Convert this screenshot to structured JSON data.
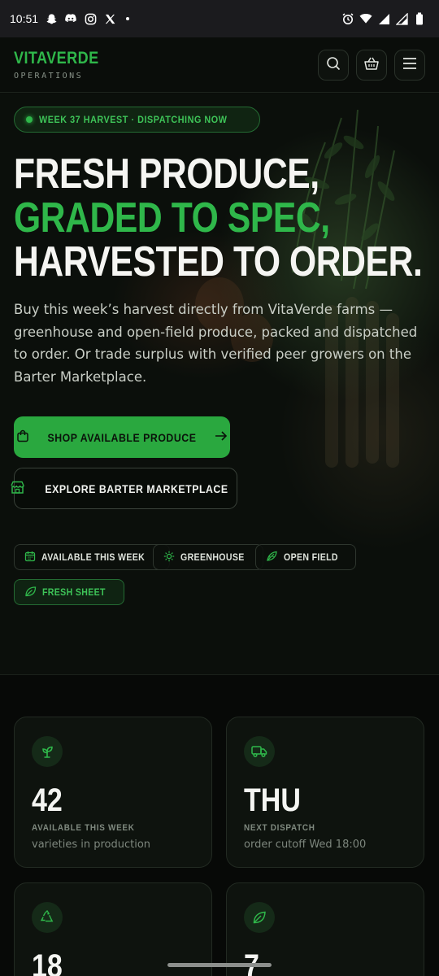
{
  "status_bar": {
    "time": "10:51",
    "left_icons": [
      "snapchat-icon",
      "discord-icon",
      "instagram-icon",
      "x-icon",
      "notification-dot"
    ],
    "right_icons": [
      "alarm-icon",
      "wifi-icon",
      "signal-icon",
      "signal-icon",
      "battery-icon"
    ]
  },
  "header": {
    "brand": "VITAVERDE",
    "subtitle": "OPERATIONS",
    "buttons": [
      "search-icon",
      "basket-icon",
      "menu-icon"
    ]
  },
  "hero": {
    "badge": "WEEK 37 HARVEST · DISPATCHING NOW",
    "headline": {
      "line1": "FRESH PRODUCE,",
      "line2": "GRADED TO SPEC,",
      "line3": "HARVESTED TO ORDER."
    },
    "description": "Buy this week’s harvest directly from VitaVerde farms — greenhouse and open-field produce, packed and dispatched to order. Or trade surplus with verified peer growers on the Barter Marketplace.",
    "primary_button": "SHOP AVAILABLE PRODUCE",
    "secondary_button": "EXPLORE BARTER MARKETPLACE",
    "chips": [
      {
        "label": "AVAILABLE THIS WEEK",
        "icon": "calendar-icon"
      },
      {
        "label": "GREENHOUSE",
        "icon": "sun-icon"
      },
      {
        "label": "OPEN FIELD",
        "icon": "seedling-icon"
      },
      {
        "label": "FRESH SHEET",
        "icon": "leaf-icon"
      }
    ]
  },
  "stats": [
    {
      "value": "42",
      "label": "AVAILABLE THIS WEEK",
      "sub": "varieties in production",
      "icon": "sprout-icon"
    },
    {
      "value": "THU",
      "label": "NEXT DISPATCH",
      "sub": "order cutoff Wed 18:00",
      "icon": "truck-icon"
    },
    {
      "value": "18",
      "label": "",
      "sub": "",
      "icon": "recycle-icon"
    },
    {
      "value": "7",
      "label": "",
      "sub": "",
      "icon": "leaf-icon"
    }
  ],
  "colors": {
    "accent": "#2fb74a",
    "background": "#0a0d0a",
    "card": "#0e130e"
  }
}
